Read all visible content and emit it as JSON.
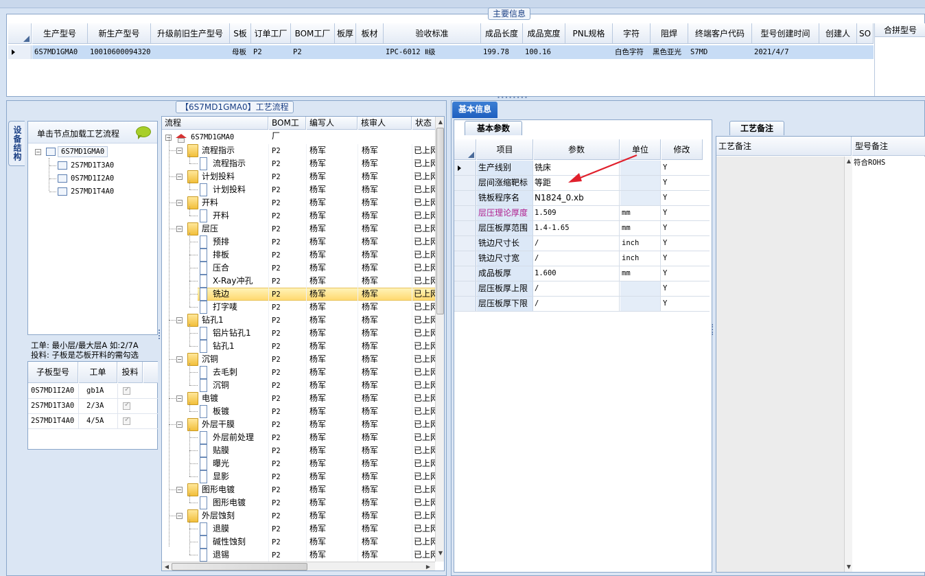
{
  "main_info": {
    "title": "主要信息",
    "columns": [
      "生产型号",
      "新生产型号",
      "升级前旧生产型号",
      "S板",
      "订单工厂",
      "BOM工厂",
      "板厚",
      "板材",
      "验收标准",
      "成品长度",
      "成品宽度",
      "PNL规格",
      "字符",
      "阻焊",
      "终端客户代码",
      "型号创建时间",
      "创建人",
      "SO"
    ],
    "row": [
      "6S7MD1GMA0",
      "10010600094320",
      "",
      "母板",
      "P2",
      "P2",
      "",
      "",
      "IPC-6012 Ⅱ级",
      "199.78",
      "100.16",
      "",
      "白色字符",
      "黑色亚光",
      "S7MD",
      "2021/4/7",
      "",
      ""
    ],
    "side_header": "合拼型号"
  },
  "process_flow_title": "【6S7MD1GMA0】工艺流程",
  "device_structure": {
    "vertical_tab": "设备结构",
    "hint": "单击节点加载工艺流程",
    "tree_root": "6S7MD1GMA0",
    "tree_children": [
      "2S7MD1T3A0",
      "0S7MD1I2A0",
      "2S7MD1T4A0"
    ],
    "note_line1": "工单: 最小层/最大层A 如:2/7A",
    "note_line2": "投料: 子板是芯板开料的需勾选",
    "sub_table": {
      "headers": [
        "子板型号",
        "工单",
        "投料"
      ],
      "rows": [
        [
          "0S7MD1I2A0",
          "gb1A"
        ],
        [
          "2S7MD1T3A0",
          "2/3A"
        ],
        [
          "2S7MD1T4A0",
          "4/5A"
        ]
      ]
    }
  },
  "flow_tree": {
    "headers": [
      "流程",
      "BOM工厂",
      "编写人",
      "核审人",
      "状态"
    ],
    "root": "6S7MD1GMA0",
    "rows": [
      {
        "name": "流程指示",
        "level": 1,
        "bom": "P2",
        "writer": "杨军",
        "reviewer": "杨军",
        "status": "已上网"
      },
      {
        "name": "流程指示",
        "level": 2,
        "bom": "P2",
        "writer": "杨军",
        "reviewer": "杨军",
        "status": "已上网"
      },
      {
        "name": "计划投料",
        "level": 1,
        "bom": "P2",
        "writer": "杨军",
        "reviewer": "杨军",
        "status": "已上网"
      },
      {
        "name": "计划投料",
        "level": 2,
        "bom": "P2",
        "writer": "杨军",
        "reviewer": "杨军",
        "status": "已上网"
      },
      {
        "name": "开料",
        "level": 1,
        "bom": "P2",
        "writer": "杨军",
        "reviewer": "杨军",
        "status": "已上网"
      },
      {
        "name": "开料",
        "level": 2,
        "bom": "P2",
        "writer": "杨军",
        "reviewer": "杨军",
        "status": "已上网"
      },
      {
        "name": "层压",
        "level": 1,
        "bom": "P2",
        "writer": "杨军",
        "reviewer": "杨军",
        "status": "已上网"
      },
      {
        "name": "预排",
        "level": 2,
        "bom": "P2",
        "writer": "杨军",
        "reviewer": "杨军",
        "status": "已上网"
      },
      {
        "name": "排板",
        "level": 2,
        "bom": "P2",
        "writer": "杨军",
        "reviewer": "杨军",
        "status": "已上网"
      },
      {
        "name": "压合",
        "level": 2,
        "bom": "P2",
        "writer": "杨军",
        "reviewer": "杨军",
        "status": "已上网"
      },
      {
        "name": "X-Ray冲孔",
        "level": 2,
        "bom": "P2",
        "writer": "杨军",
        "reviewer": "杨军",
        "status": "已上网"
      },
      {
        "name": "铣边",
        "level": 2,
        "bom": "P2",
        "writer": "杨军",
        "reviewer": "杨军",
        "status": "已上网",
        "selected": true
      },
      {
        "name": "打字唛",
        "level": 2,
        "bom": "P2",
        "writer": "杨军",
        "reviewer": "杨军",
        "status": "已上网"
      },
      {
        "name": "钻孔1",
        "level": 1,
        "bom": "P2",
        "writer": "杨军",
        "reviewer": "杨军",
        "status": "已上网"
      },
      {
        "name": "铝片钻孔1",
        "level": 2,
        "bom": "P2",
        "writer": "杨军",
        "reviewer": "杨军",
        "status": "已上网"
      },
      {
        "name": "钻孔1",
        "level": 2,
        "bom": "P2",
        "writer": "杨军",
        "reviewer": "杨军",
        "status": "已上网"
      },
      {
        "name": "沉铜",
        "level": 1,
        "bom": "P2",
        "writer": "杨军",
        "reviewer": "杨军",
        "status": "已上网"
      },
      {
        "name": "去毛刺",
        "level": 2,
        "bom": "P2",
        "writer": "杨军",
        "reviewer": "杨军",
        "status": "已上网"
      },
      {
        "name": "沉铜",
        "level": 2,
        "bom": "P2",
        "writer": "杨军",
        "reviewer": "杨军",
        "status": "已上网"
      },
      {
        "name": "电镀",
        "level": 1,
        "bom": "P2",
        "writer": "杨军",
        "reviewer": "杨军",
        "status": "已上网"
      },
      {
        "name": "板镀",
        "level": 2,
        "bom": "P2",
        "writer": "杨军",
        "reviewer": "杨军",
        "status": "已上网"
      },
      {
        "name": "外层干膜",
        "level": 1,
        "bom": "P2",
        "writer": "杨军",
        "reviewer": "杨军",
        "status": "已上网"
      },
      {
        "name": "外层前处理",
        "level": 2,
        "bom": "P2",
        "writer": "杨军",
        "reviewer": "杨军",
        "status": "已上网"
      },
      {
        "name": "贴膜",
        "level": 2,
        "bom": "P2",
        "writer": "杨军",
        "reviewer": "杨军",
        "status": "已上网"
      },
      {
        "name": "曝光",
        "level": 2,
        "bom": "P2",
        "writer": "杨军",
        "reviewer": "杨军",
        "status": "已上网"
      },
      {
        "name": "显影",
        "level": 2,
        "bom": "P2",
        "writer": "杨军",
        "reviewer": "杨军",
        "status": "已上网"
      },
      {
        "name": "图形电镀",
        "level": 1,
        "bom": "P2",
        "writer": "杨军",
        "reviewer": "杨军",
        "status": "已上网"
      },
      {
        "name": "图形电镀",
        "level": 2,
        "bom": "P2",
        "writer": "杨军",
        "reviewer": "杨军",
        "status": "已上网"
      },
      {
        "name": "外层蚀刻",
        "level": 1,
        "bom": "P2",
        "writer": "杨军",
        "reviewer": "杨军",
        "status": "已上网"
      },
      {
        "name": "退膜",
        "level": 2,
        "bom": "P2",
        "writer": "杨军",
        "reviewer": "杨军",
        "status": "已上网"
      },
      {
        "name": "碱性蚀刻",
        "level": 2,
        "bom": "P2",
        "writer": "杨军",
        "reviewer": "杨军",
        "status": "已上网"
      },
      {
        "name": "退锡",
        "level": 2,
        "bom": "P2",
        "writer": "杨军",
        "reviewer": "杨军",
        "status": "已上网"
      }
    ]
  },
  "basic_info": {
    "tab": "基本信息",
    "subtab": "基本参数",
    "headers": [
      "项目",
      "参数",
      "单位",
      "修改"
    ],
    "rows": [
      {
        "item": "生产线别",
        "param": "铣床",
        "unit": "",
        "mod": "Y"
      },
      {
        "item": "层间涨缩靶标",
        "param": "等距",
        "unit": "",
        "mod": "Y"
      },
      {
        "item": "铣板程序名",
        "param": "N1824_0.xb",
        "unit": "",
        "mod": "Y"
      },
      {
        "item": "层压理论厚度",
        "param": "1.509",
        "unit": "mm",
        "mod": "Y",
        "highlight": true
      },
      {
        "item": "层压板厚范围",
        "param": "1.4-1.65",
        "unit": "mm",
        "mod": "Y"
      },
      {
        "item": "铣边尺寸长",
        "param": "/",
        "unit": "inch",
        "mod": "Y"
      },
      {
        "item": "铣边尺寸宽",
        "param": "/",
        "unit": "inch",
        "mod": "Y"
      },
      {
        "item": "成品板厚",
        "param": "1.600",
        "unit": "mm",
        "mod": "Y"
      },
      {
        "item": "层压板厚上限",
        "param": "/",
        "unit": "",
        "mod": "Y"
      },
      {
        "item": "层压板厚下限",
        "param": "/",
        "unit": "",
        "mod": "Y"
      }
    ]
  },
  "process_notes": {
    "tab": "工艺备注",
    "col1": "工艺备注",
    "col2": "型号备注",
    "model_note": "符合ROHS"
  },
  "colors": {
    "highlight_text": "#b0218f",
    "selected_row": "#ffe58a",
    "accent": "#1f5fbf",
    "arrow": "#e0202c"
  }
}
